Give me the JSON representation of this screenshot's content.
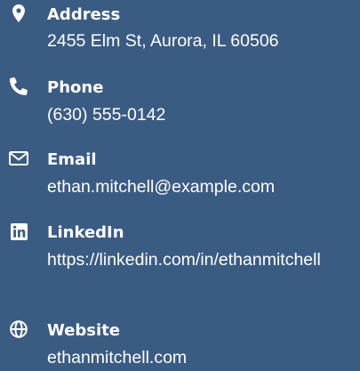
{
  "contacts": {
    "address": {
      "icon": "map-marker-icon",
      "label": "Address",
      "value": "2455 Elm St, Aurora, IL 60506"
    },
    "phone": {
      "icon": "phone-icon",
      "label": "Phone",
      "value": "(630) 555-0142"
    },
    "email": {
      "icon": "envelope-icon",
      "label": "Email",
      "value": "ethan.mitchell@example.com"
    },
    "linkedin": {
      "icon": "linkedin-icon",
      "label": "LinkedIn",
      "value": "https://linkedin.com/in/ethanmitchell"
    },
    "website": {
      "icon": "globe-icon",
      "label": "Website",
      "value": "ethanmitchell.com"
    }
  },
  "colors": {
    "background": "#3b5c82",
    "text": "#ffffff"
  }
}
